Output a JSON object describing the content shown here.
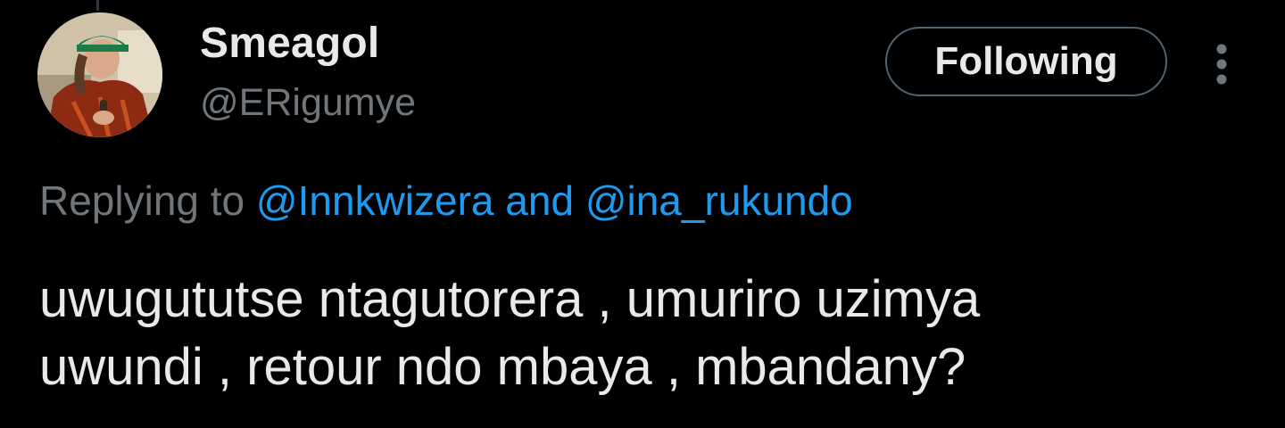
{
  "tweet": {
    "author": {
      "display_name": "Smeagol",
      "handle": "@ERigumye",
      "avatar_icon": "profile-photo"
    },
    "follow_button": {
      "label": "Following"
    },
    "more_icon": "more-vertical-icon",
    "reply_context": {
      "prefix": "Replying to",
      "mentions": [
        "@Innkwizera",
        "@ina_rukundo"
      ],
      "conjunction": "and"
    },
    "text_lines": [
      "uwugututse ntagutorera , umuriro uzimya",
      "uwundi , retour ndo mbaya , mbandany?"
    ]
  },
  "colors": {
    "background": "#000000",
    "primary_text": "#e7e9ea",
    "secondary_text": "#71767b",
    "link": "#1d9bf0",
    "button_border": "#536471"
  }
}
